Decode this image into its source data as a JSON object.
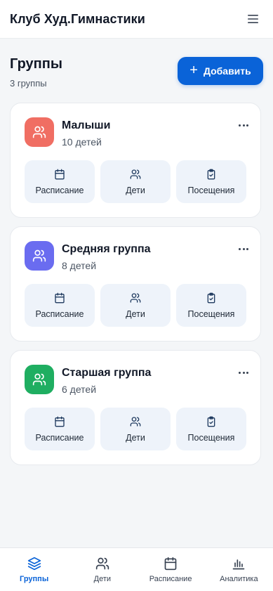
{
  "header": {
    "app_title": "Клуб Худ.Гимнастики"
  },
  "page": {
    "title": "Группы",
    "count": "3 группы",
    "add_label": "Добавить"
  },
  "groups": [
    {
      "name": "Малыши",
      "children": "10 детей",
      "color": "#f06e63",
      "actions": {
        "schedule": "Расписание",
        "kids": "Дети",
        "attendance": "Посещения"
      }
    },
    {
      "name": "Средняя группа",
      "children": "8 детей",
      "color": "#6a6cf0",
      "actions": {
        "schedule": "Расписание",
        "kids": "Дети",
        "attendance": "Посещения"
      }
    },
    {
      "name": "Старшая группа",
      "children": "6 детей",
      "color": "#1fae61",
      "actions": {
        "schedule": "Расписание",
        "kids": "Дети",
        "attendance": "Посещения"
      }
    }
  ],
  "nav": {
    "groups": "Группы",
    "kids": "Дети",
    "schedule": "Расписание",
    "analytics": "Аналитика"
  },
  "colors": {
    "accent": "#0a63d8",
    "action_bg": "#eef3fa"
  }
}
